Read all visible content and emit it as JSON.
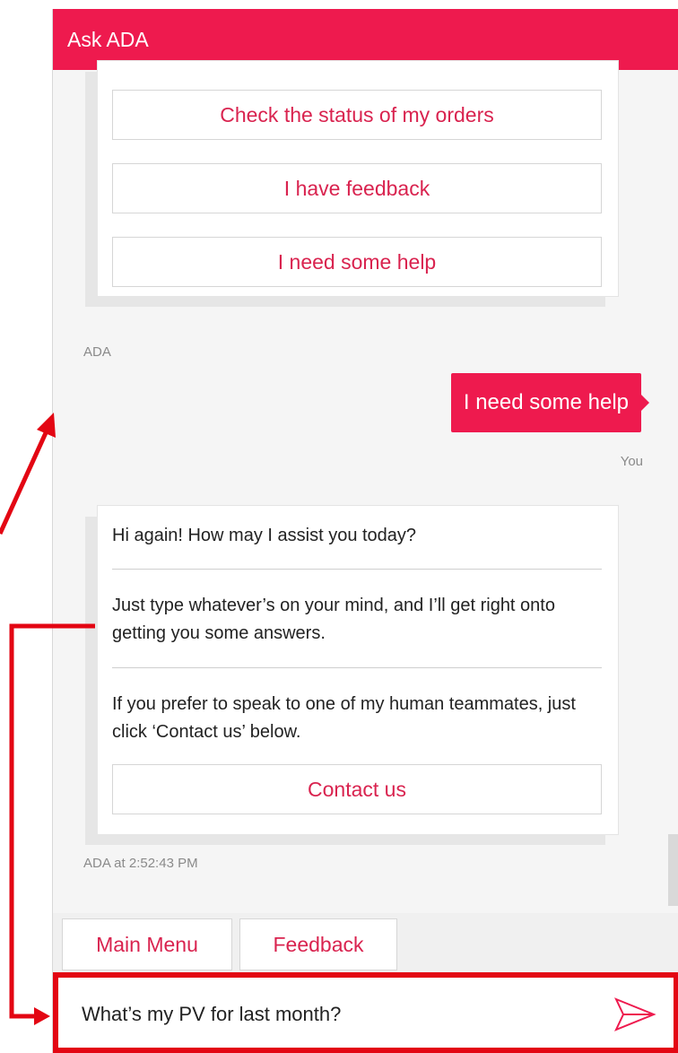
{
  "header": {
    "title": "Ask ADA"
  },
  "menu_options": [
    "Check the status of my orders",
    "I have feedback",
    "I need some help"
  ],
  "bot_label": "ADA",
  "user_message": {
    "text": "I need some help",
    "sender": "You"
  },
  "bot_reply": {
    "paragraphs": [
      "Hi again! How may I assist you today?",
      "Just type whatever’s on your mind, and I’ll get right onto getting you some answers.",
      "If you prefer to speak to one of my human teammates, just click ‘Contact us’ below."
    ],
    "button": "Contact us",
    "timestamp": "ADA at 2:52:43 PM"
  },
  "quick_actions": [
    "Main Menu",
    "Feedback"
  ],
  "input": {
    "value": "What’s my PV for last month?"
  },
  "colors": {
    "brand": "#ee1a4e",
    "link": "#d9234f",
    "annotation": "#e30613"
  }
}
